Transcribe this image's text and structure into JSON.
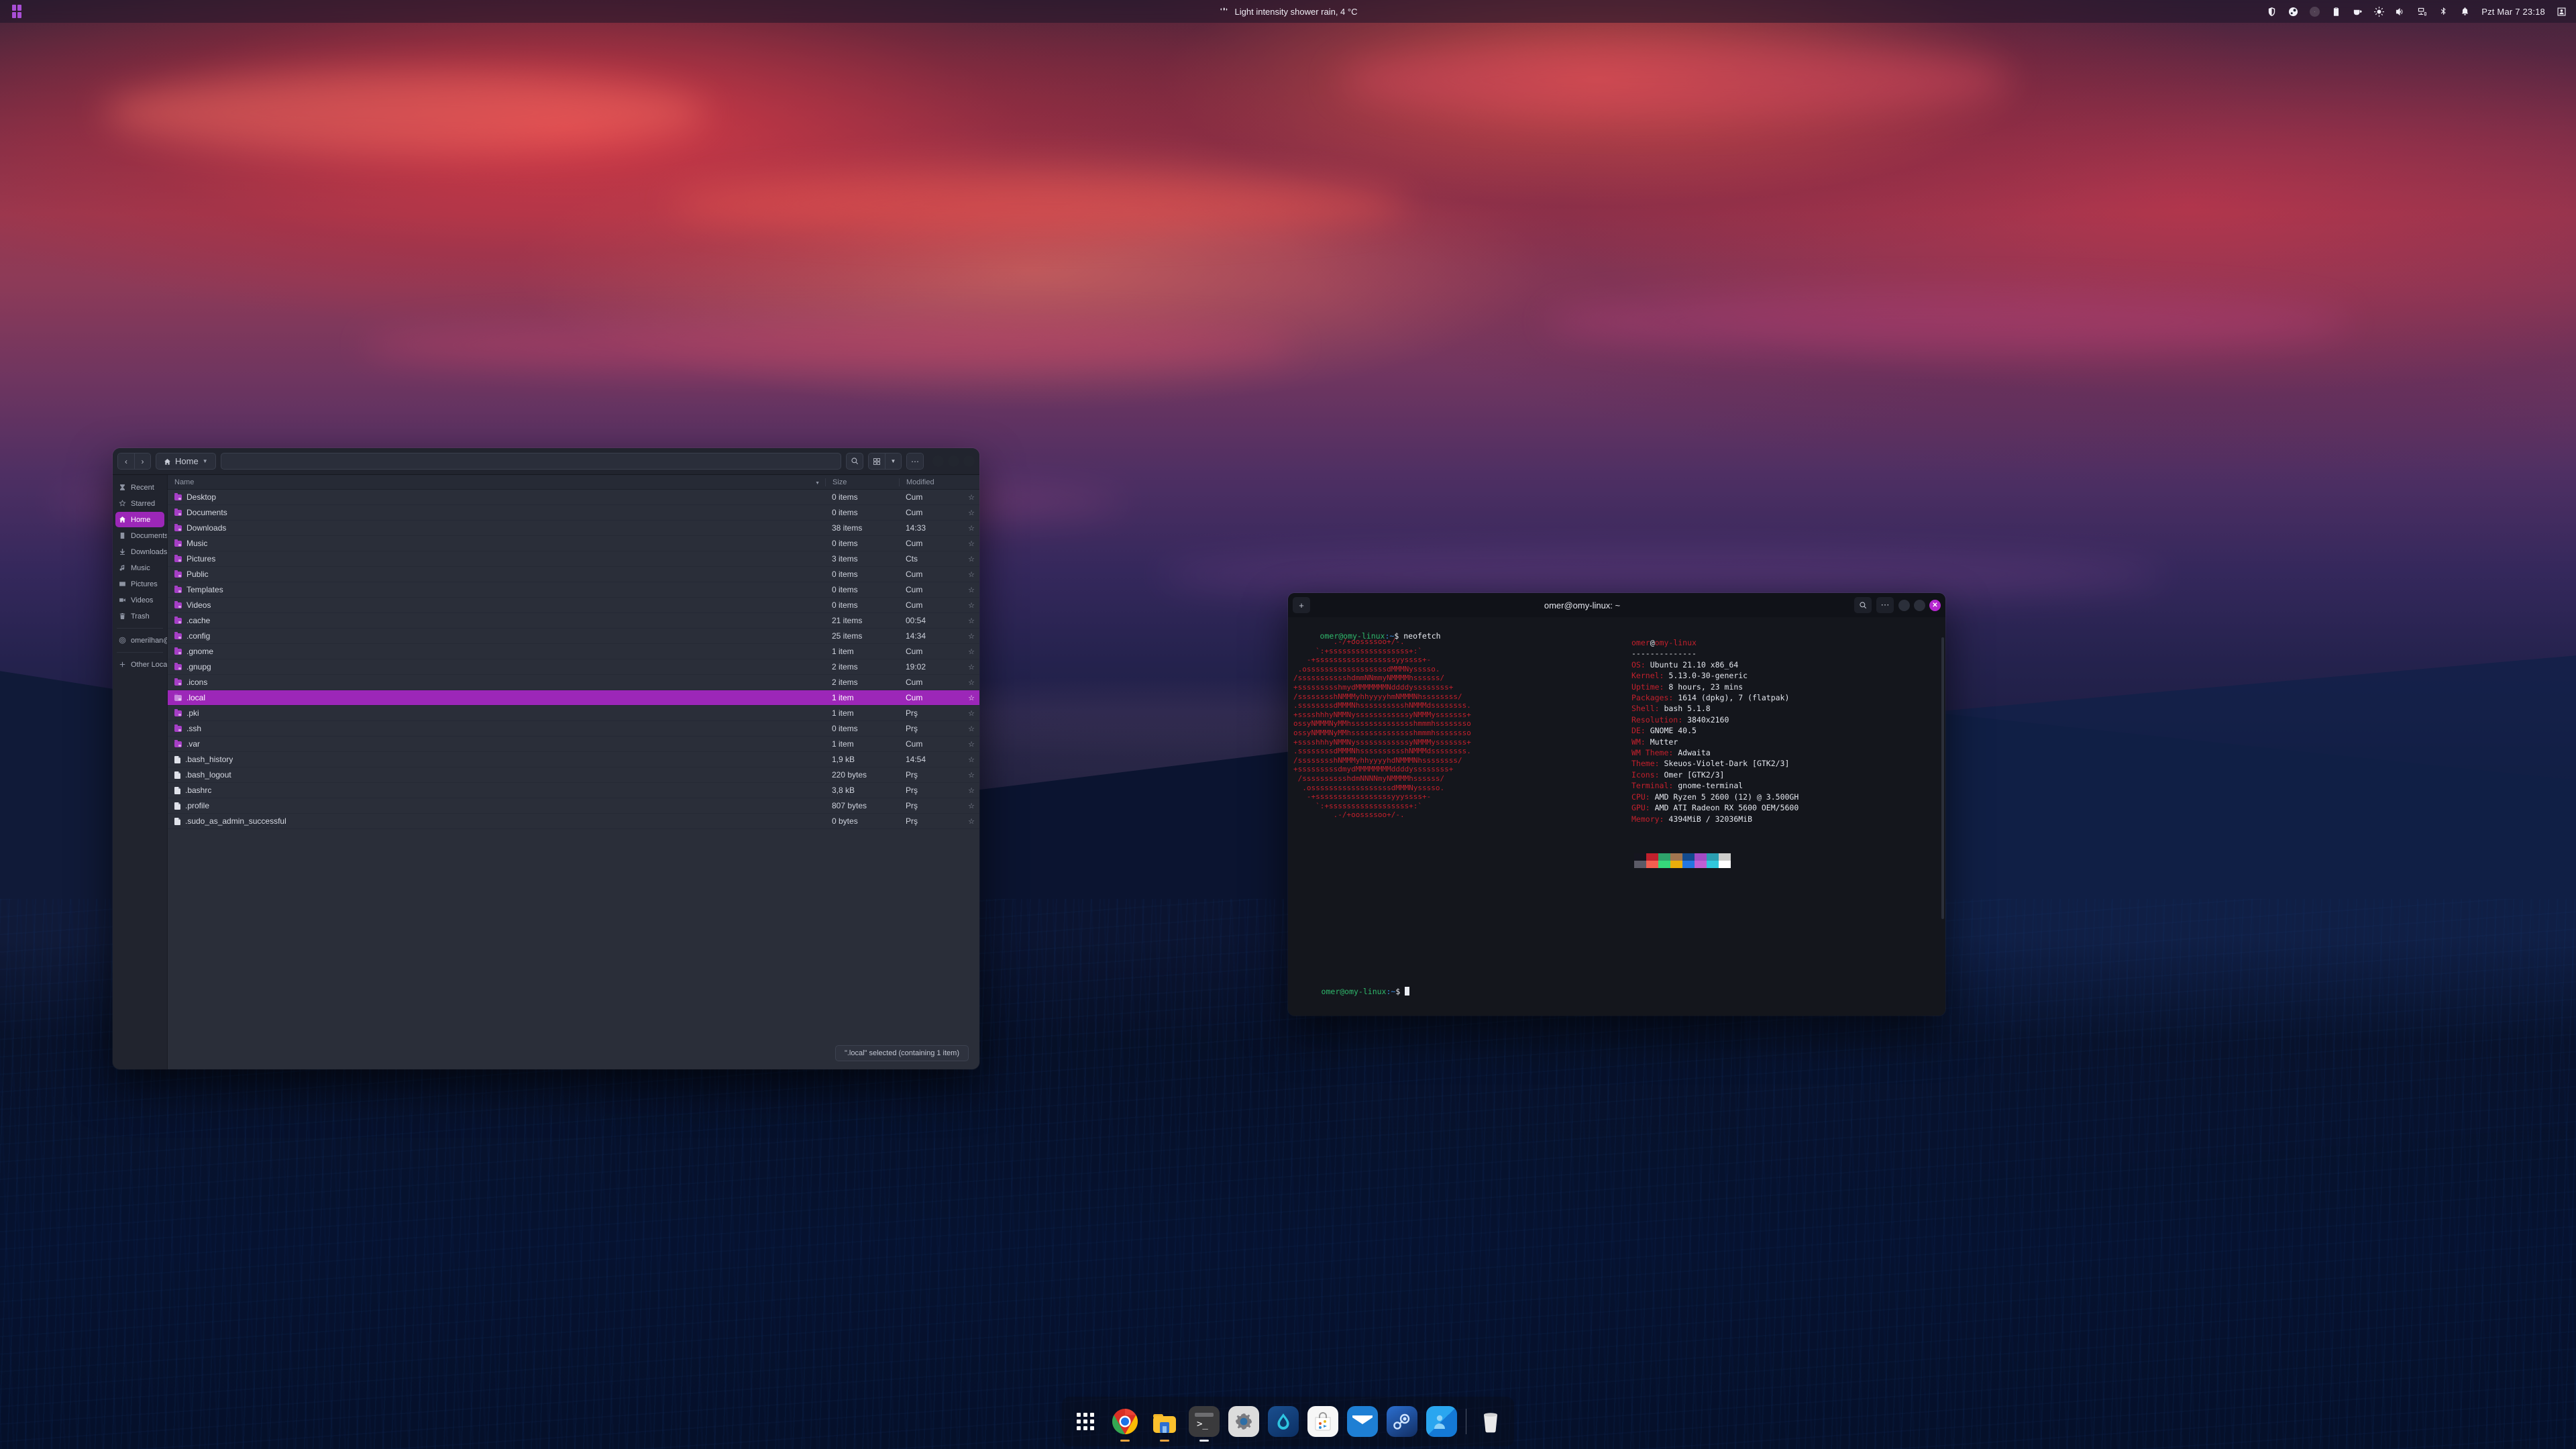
{
  "topbar": {
    "activities_label": "Activities",
    "weather": {
      "icon": "rain-icon",
      "text": "Light intensity shower rain, 4 °C"
    },
    "tray": [
      {
        "name": "shield-icon",
        "label": "Security"
      },
      {
        "name": "steam-icon",
        "label": "Steam"
      },
      {
        "name": "screenshot-camera-icon",
        "label": "Screenshot",
        "highlighted": true
      },
      {
        "name": "clipboard-icon",
        "label": "Clipboard"
      },
      {
        "name": "coffee-icon",
        "label": "Caffeine"
      },
      {
        "name": "brightness-icon",
        "label": "Brightness"
      },
      {
        "name": "volume-icon",
        "label": "Volume"
      },
      {
        "name": "network-icon",
        "label": "Network"
      },
      {
        "name": "bluetooth-icon",
        "label": "Bluetooth"
      },
      {
        "name": "notification-bell-icon",
        "label": "Notifications"
      }
    ],
    "clock": "Pzt Mar 7  23:18",
    "user_icon": "user-account-icon"
  },
  "files_window": {
    "title": "Home",
    "breadcrumb": {
      "icon": "home-icon",
      "label": "Home",
      "chevron": "▼"
    },
    "header_buttons": {
      "back": "‹",
      "forward": "›",
      "search": "search-icon",
      "view_grid": "grid-view-icon",
      "view_dropdown": "▼",
      "menu": "⋯"
    },
    "search_placeholder": "",
    "sidebar": [
      {
        "label": "Recent",
        "icon": "clock-icon",
        "active": false
      },
      {
        "label": "Starred",
        "icon": "star-icon",
        "active": false
      },
      {
        "label": "Home",
        "icon": "home-icon",
        "active": true
      },
      {
        "label": "Documents",
        "icon": "document-icon",
        "active": false
      },
      {
        "label": "Downloads",
        "icon": "download-icon",
        "active": false
      },
      {
        "label": "Music",
        "icon": "music-note-icon",
        "active": false
      },
      {
        "label": "Pictures",
        "icon": "image-icon",
        "active": false
      },
      {
        "label": "Videos",
        "icon": "video-camera-icon",
        "active": false
      },
      {
        "label": "Trash",
        "icon": "trash-icon",
        "active": false
      },
      {
        "label": "omerilhan@gm…",
        "icon": "network-share-icon",
        "active": false,
        "separator_before": true
      },
      {
        "label": "Other Locations",
        "icon": "plus-icon",
        "active": false,
        "separator_before": true
      }
    ],
    "columns": {
      "name": "Name",
      "size": "Size",
      "modified": "Modified",
      "sort": "▼"
    },
    "rows": [
      {
        "name": "Desktop",
        "type": "folder",
        "size": "0 items",
        "modified": "Cum",
        "starred": false,
        "selected": false
      },
      {
        "name": "Documents",
        "type": "folder",
        "size": "0 items",
        "modified": "Cum",
        "starred": false,
        "selected": false
      },
      {
        "name": "Downloads",
        "type": "folder",
        "size": "38 items",
        "modified": "14:33",
        "starred": false,
        "selected": false
      },
      {
        "name": "Music",
        "type": "folder",
        "size": "0 items",
        "modified": "Cum",
        "starred": false,
        "selected": false
      },
      {
        "name": "Pictures",
        "type": "folder",
        "size": "3 items",
        "modified": "Cts",
        "starred": false,
        "selected": false
      },
      {
        "name": "Public",
        "type": "folder",
        "size": "0 items",
        "modified": "Cum",
        "starred": false,
        "selected": false
      },
      {
        "name": "Templates",
        "type": "folder",
        "size": "0 items",
        "modified": "Cum",
        "starred": false,
        "selected": false
      },
      {
        "name": "Videos",
        "type": "folder",
        "size": "0 items",
        "modified": "Cum",
        "starred": false,
        "selected": false
      },
      {
        "name": ".cache",
        "type": "folder",
        "size": "21 items",
        "modified": "00:54",
        "starred": false,
        "selected": false
      },
      {
        "name": ".config",
        "type": "folder",
        "size": "25 items",
        "modified": "14:34",
        "starred": false,
        "selected": false
      },
      {
        "name": ".gnome",
        "type": "folder",
        "size": "1 item",
        "modified": "Cum",
        "starred": false,
        "selected": false
      },
      {
        "name": ".gnupg",
        "type": "folder",
        "size": "2 items",
        "modified": "19:02",
        "starred": false,
        "selected": false
      },
      {
        "name": ".icons",
        "type": "folder",
        "size": "2 items",
        "modified": "Cum",
        "starred": false,
        "selected": false
      },
      {
        "name": ".local",
        "type": "folder",
        "size": "1 item",
        "modified": "Cum",
        "starred": false,
        "selected": true
      },
      {
        "name": ".pki",
        "type": "folder",
        "size": "1 item",
        "modified": "Prş",
        "starred": false,
        "selected": false
      },
      {
        "name": ".ssh",
        "type": "folder",
        "size": "0 items",
        "modified": "Prş",
        "starred": false,
        "selected": false
      },
      {
        "name": ".var",
        "type": "folder",
        "size": "1 item",
        "modified": "Cum",
        "starred": false,
        "selected": false
      },
      {
        "name": ".bash_history",
        "type": "file",
        "size": "1,9 kB",
        "modified": "14:54",
        "starred": false,
        "selected": false
      },
      {
        "name": ".bash_logout",
        "type": "file",
        "size": "220 bytes",
        "modified": "Prş",
        "starred": false,
        "selected": false
      },
      {
        "name": ".bashrc",
        "type": "file",
        "size": "3,8 kB",
        "modified": "Prş",
        "starred": false,
        "selected": false
      },
      {
        "name": ".profile",
        "type": "file",
        "size": "807 bytes",
        "modified": "Prş",
        "starred": false,
        "selected": false
      },
      {
        "name": ".sudo_as_admin_successful",
        "type": "file",
        "size": "0 bytes",
        "modified": "Prş",
        "starred": false,
        "selected": false
      }
    ],
    "status": "\".local\" selected (containing 1 item)"
  },
  "terminal": {
    "title": "omer@omy-linux: ~",
    "new_tab_label": "+",
    "search_icon": "search-icon",
    "menu_icon": "⋯",
    "close_icon": "✕",
    "command_line": {
      "user_host": "omer@omy-linux",
      "path": ":~",
      "sigil": "$",
      "command": "neofetch"
    },
    "prompt_line": {
      "user_host": "omer@omy-linux",
      "path": ":~",
      "sigil": "$"
    },
    "neofetch": {
      "header_user": "omer",
      "header_at": "@",
      "header_host": "omy-linux",
      "rule": "--------------",
      "entries": [
        {
          "key": "OS",
          "value": "Ubuntu 21.10 x86_64"
        },
        {
          "key": "Kernel",
          "value": "5.13.0-30-generic"
        },
        {
          "key": "Uptime",
          "value": "8 hours, 23 mins"
        },
        {
          "key": "Packages",
          "value": "1614 (dpkg), 7 (flatpak)"
        },
        {
          "key": "Shell",
          "value": "bash 5.1.8"
        },
        {
          "key": "Resolution",
          "value": "3840x2160"
        },
        {
          "key": "DE",
          "value": "GNOME 40.5"
        },
        {
          "key": "WM",
          "value": "Mutter"
        },
        {
          "key": "WM Theme",
          "value": "Adwaita"
        },
        {
          "key": "Theme",
          "value": "Skeuos-Violet-Dark [GTK2/3]"
        },
        {
          "key": "Icons",
          "value": "Omer [GTK2/3]"
        },
        {
          "key": "Terminal",
          "value": "gnome-terminal"
        },
        {
          "key": "CPU",
          "value": "AMD Ryzen 5 2600 (12) @ 3.500GH"
        },
        {
          "key": "GPU",
          "value": "AMD ATI Radeon RX 5600 OEM/5600"
        },
        {
          "key": "Memory",
          "value": "4394MiB / 32036MiB"
        }
      ],
      "ascii": "         .-/+oossssoo+/-.\n     `:+ssssssssssssssssss+:`\n   -+ssssssssssssssssssyyssss+-\n .ossssssssssssssssssdMMMNysssso.\n/ssssssssssshdmmNNmmyNMMMMhssssss/\n+ssssssssshmydMMMMMMMNddddyssssssss+\n/sssssssshNMMMyhhyyyyhmNMMMNhssssssss/\n.ssssssssdMMMNhsssssssssshNMMMdssssssss.\n+sssshhhyNMMNyssssssssssssyNMMMysssssss+\nossyNMMMNyMMhsssssssssssssshmmmhssssssso\nossyNMMMNyMMhsssssssssssssshmmmhssssssso\n+sssshhhyNMMNyssssssssssssyNMMMysssssss+\n.ssssssssdMMMNhsssssssssshNMMMdssssssss.\n/sssssssshNMMMyhhyyyyhdNMMMNhssssssss/\n+sssssssssdmydMMMMMMMMddddyssssssss+\n /sssssssssshdmNNNNmyNMMMMhssssss/\n  .ossssssssssssssssssdMMMNysssso.\n   -+sssssssssssssssssyyyssss+-\n     `:+ssssssssssssssssss+:`\n         .-/+oossssoo+/-.",
      "palette_row1": [
        "#15151f",
        "#c0202c",
        "#2ea36a",
        "#a2754f",
        "#134b8e",
        "#a24bc4",
        "#2b9eb0",
        "#cdcdcb"
      ],
      "palette_row2": [
        "#5b5a66",
        "#f25f50",
        "#36d97a",
        "#eaad0b",
        "#2376e0",
        "#c05fd4",
        "#31c8dd",
        "#ffffff"
      ]
    }
  },
  "dock": {
    "items": [
      {
        "name": "show-applications",
        "label": "Show Applications",
        "running": false
      },
      {
        "name": "google-chrome",
        "label": "Google Chrome",
        "running": true
      },
      {
        "name": "files-nautilus",
        "label": "Files",
        "running": true
      },
      {
        "name": "terminal",
        "label": "Terminal",
        "running": true
      },
      {
        "name": "settings",
        "label": "Settings",
        "running": false
      },
      {
        "name": "drop-app",
        "label": "Rhythm",
        "running": false
      },
      {
        "name": "software-store",
        "label": "Ubuntu Software",
        "running": false
      },
      {
        "name": "mail",
        "label": "Mail",
        "running": false
      },
      {
        "name": "steam",
        "label": "Steam",
        "running": false
      },
      {
        "name": "contacts",
        "label": "Contacts",
        "running": false
      },
      {
        "name": "separator",
        "label": "",
        "running": false
      },
      {
        "name": "trash",
        "label": "Trash",
        "running": false
      }
    ]
  },
  "colors": {
    "accent_purple": "#9c27b8",
    "window_bg": "#262a35",
    "sidebar_bg": "#21242e",
    "terminal_bg": "#14161c",
    "prompt_green": "#2fb86b",
    "neofetch_red": "#c3202c"
  }
}
